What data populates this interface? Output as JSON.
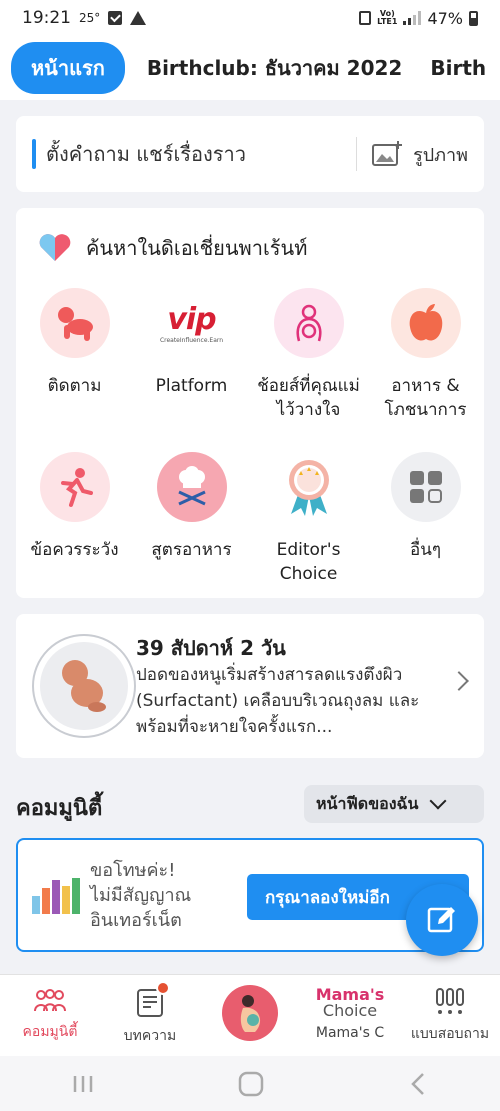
{
  "status_bar": {
    "time": "19:21",
    "temperature": "25°",
    "battery": "47%"
  },
  "tabs": [
    {
      "label": "หน้าแรก",
      "active": true
    },
    {
      "label": "Birthclub: ธันวาคม 2022",
      "active": false
    },
    {
      "label": "Birth",
      "active": false
    }
  ],
  "ask": {
    "prompt": "ตั้งคำถาม แชร์เรื่องราว",
    "photo_label": "รูปภาพ"
  },
  "search": {
    "title": "ค้นหาในดิเอเชี่ยนพาเร้นท์",
    "categories": [
      {
        "label": "ติดตาม",
        "icon": "baby-crawl-icon"
      },
      {
        "label": "Platform",
        "icon": "vip-logo-icon",
        "logo_text": "vip",
        "logo_sub": "CreateInfluence.Earn"
      },
      {
        "label": "ช้อยส์ที่คุณแม่ไว้วางใจ",
        "icon": "mother-baby-icon"
      },
      {
        "label": "อาหาร & โภชนาการ",
        "icon": "apple-icon"
      },
      {
        "label": "ข้อควรระวัง",
        "icon": "running-person-icon"
      },
      {
        "label": "สูตรอาหาร",
        "icon": "chef-hat-icon"
      },
      {
        "label": "Editor's Choice",
        "icon": "award-ribbon-icon"
      },
      {
        "label": "อื่นๆ",
        "icon": "more-grid-icon"
      }
    ]
  },
  "baby": {
    "week_title": "39 สัปดาห์ 2  วัน",
    "description": "ปอดของหนูเริ่มสร้างสารลดแรงตึงผิว (Surfactant) เคลือบบริเวณถุงลม และพร้อมที่จะหายใจครั้งแรก..."
  },
  "community": {
    "title": "คอมมูนิตี้",
    "feed_selector": "หน้าฟีดของฉัน",
    "offline_message_1": "ขอโทษค่ะ!",
    "offline_message_2": "ไม่มีสัญญาณ",
    "offline_message_3": "อินเทอร์เน็ต",
    "retry_label": "กรุณาลองใหม่อีก"
  },
  "bottom_nav": [
    {
      "label": "คอมมูนิตี้",
      "icon": "community-icon",
      "active": true
    },
    {
      "label": "บทความ",
      "icon": "article-icon",
      "active": false,
      "badge": true
    },
    {
      "label": "",
      "icon": "pregnancy-icon",
      "active": false
    },
    {
      "label": "Mama's C",
      "icon": "mamas-choice-logo",
      "active": false,
      "logo_top": "Mama's",
      "logo_bottom": "Choice"
    },
    {
      "label": "แบบสอบถาม",
      "icon": "poll-icon",
      "active": false
    }
  ],
  "colors": {
    "accent": "#1f8ef1",
    "active_nav": "#e24a5e",
    "background": "#f1f2f6"
  }
}
